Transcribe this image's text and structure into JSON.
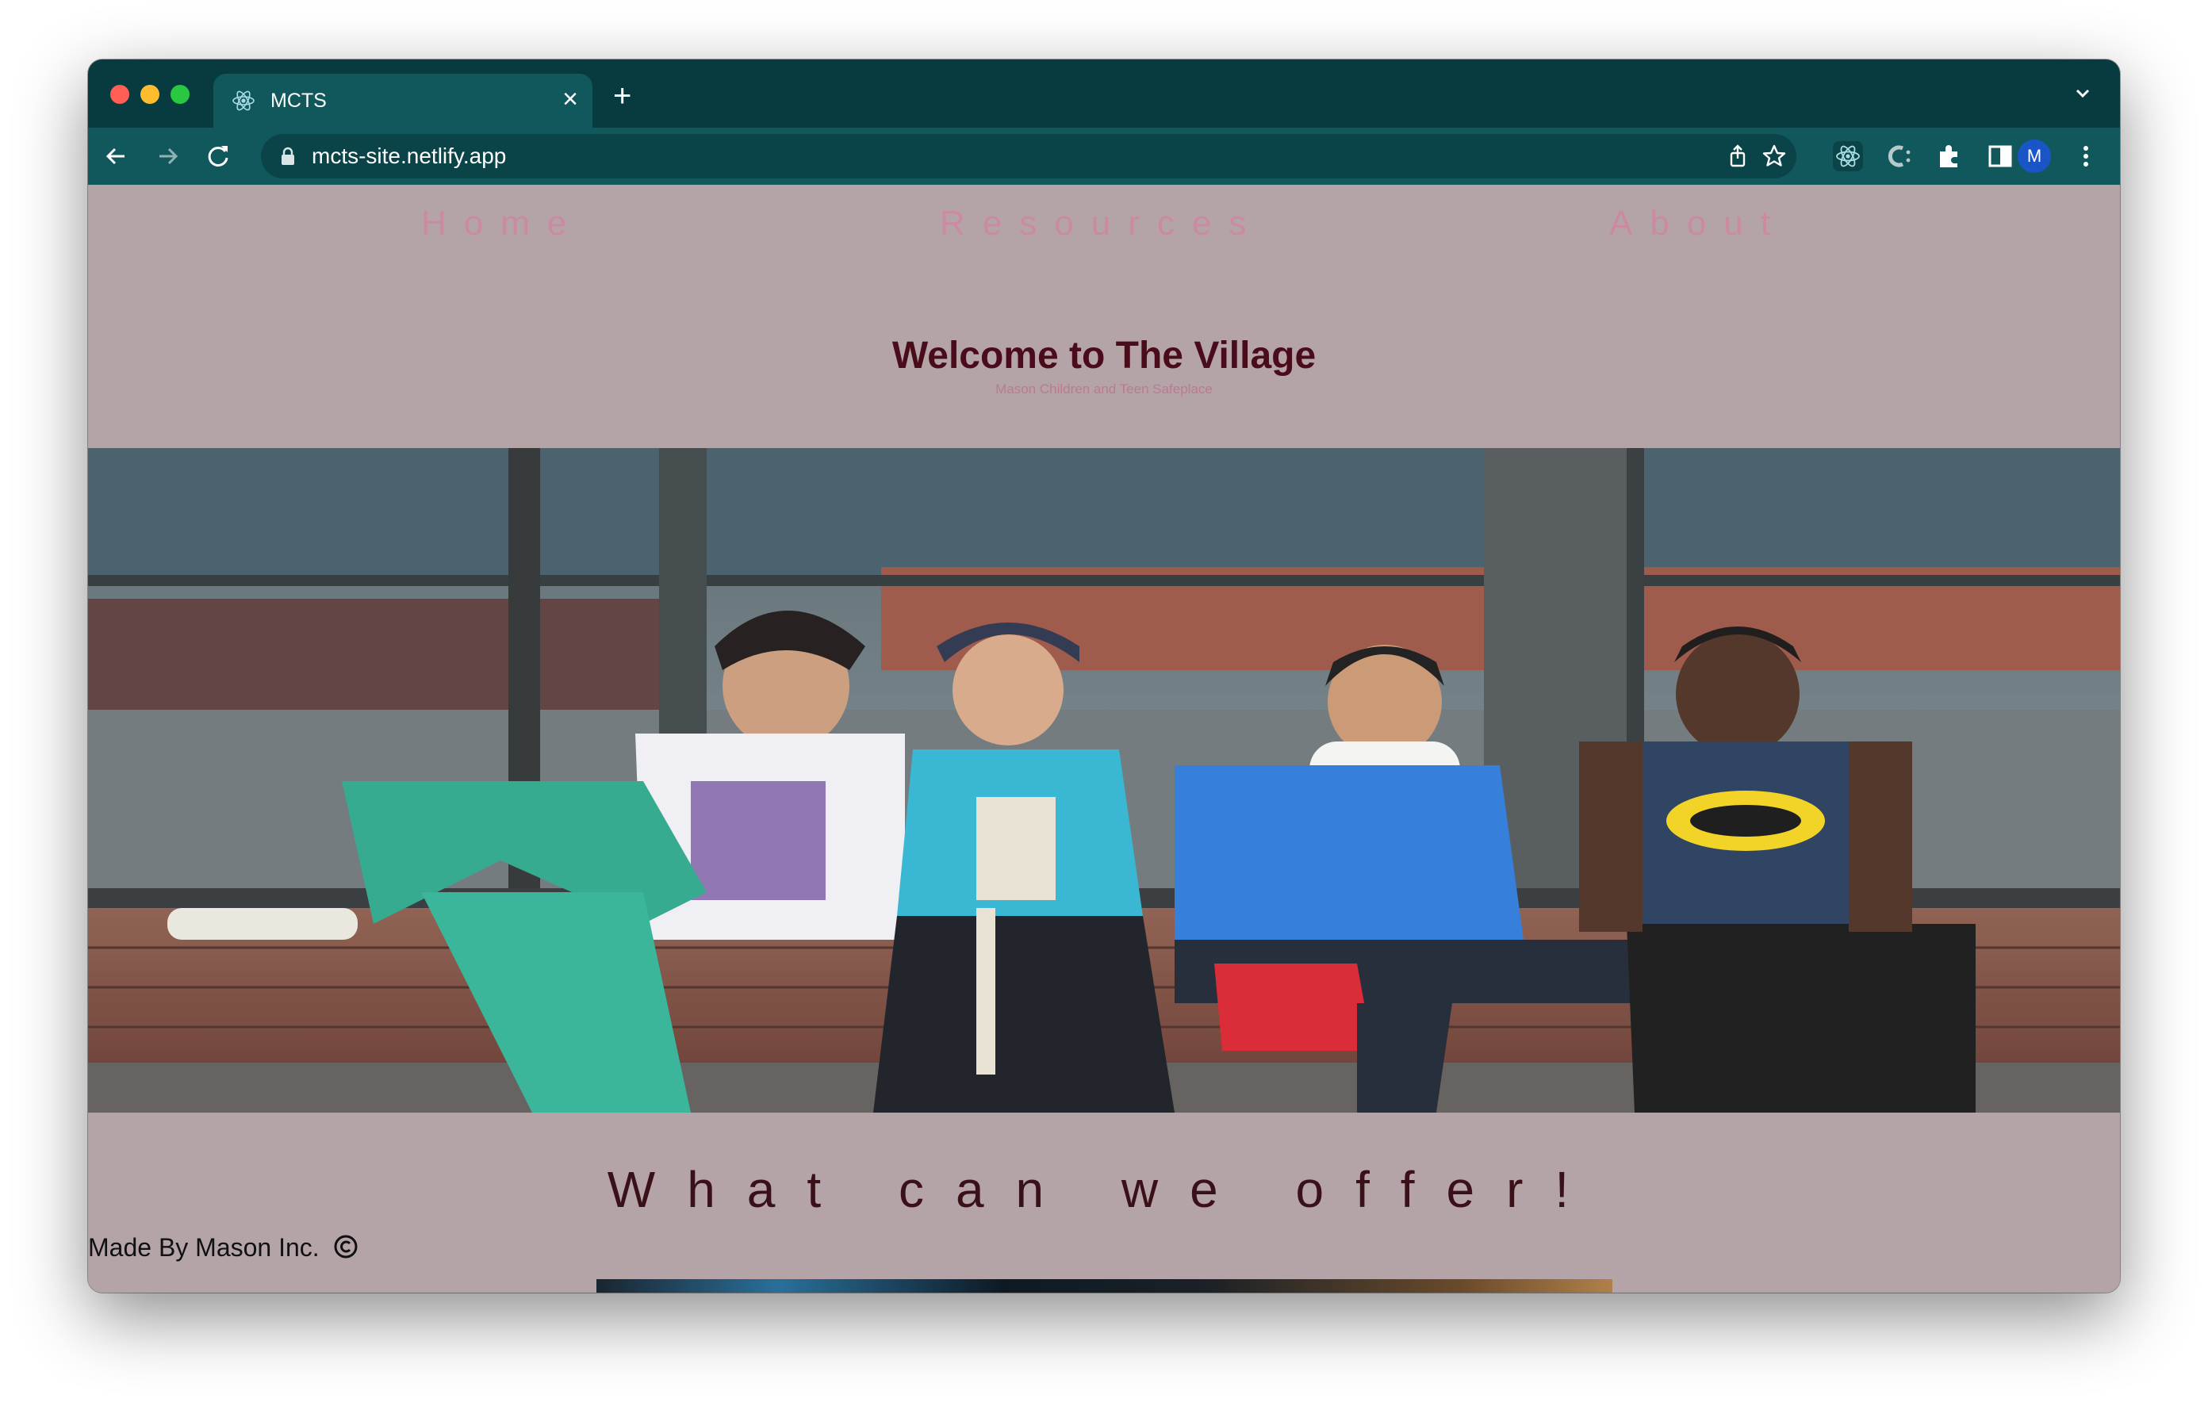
{
  "browser": {
    "tab": {
      "title": "MCTS",
      "icon": "react-icon"
    },
    "url": "mcts-site.netlify.app",
    "profile_initial": "M",
    "colors": {
      "tabstrip": "#073b40",
      "toolbar": "#11585d",
      "active_tab": "#11585d"
    }
  },
  "page": {
    "nav": {
      "home": "Home",
      "resources": "Resources",
      "about": "About"
    },
    "hero": {
      "title": "Welcome to The Village",
      "subtitle": "Mason Children and Teen Safeplace"
    },
    "photo": {
      "subject": "four-teens-sitting-on-brick-ledge"
    },
    "offer_heading": "What can we offer!",
    "footer": {
      "credit": "Made By Mason Inc."
    },
    "colors": {
      "background": "#b4a4a8",
      "nav_link": "#cc8aa0",
      "title": "#4a0c1a",
      "offer": "#3a1119"
    }
  }
}
